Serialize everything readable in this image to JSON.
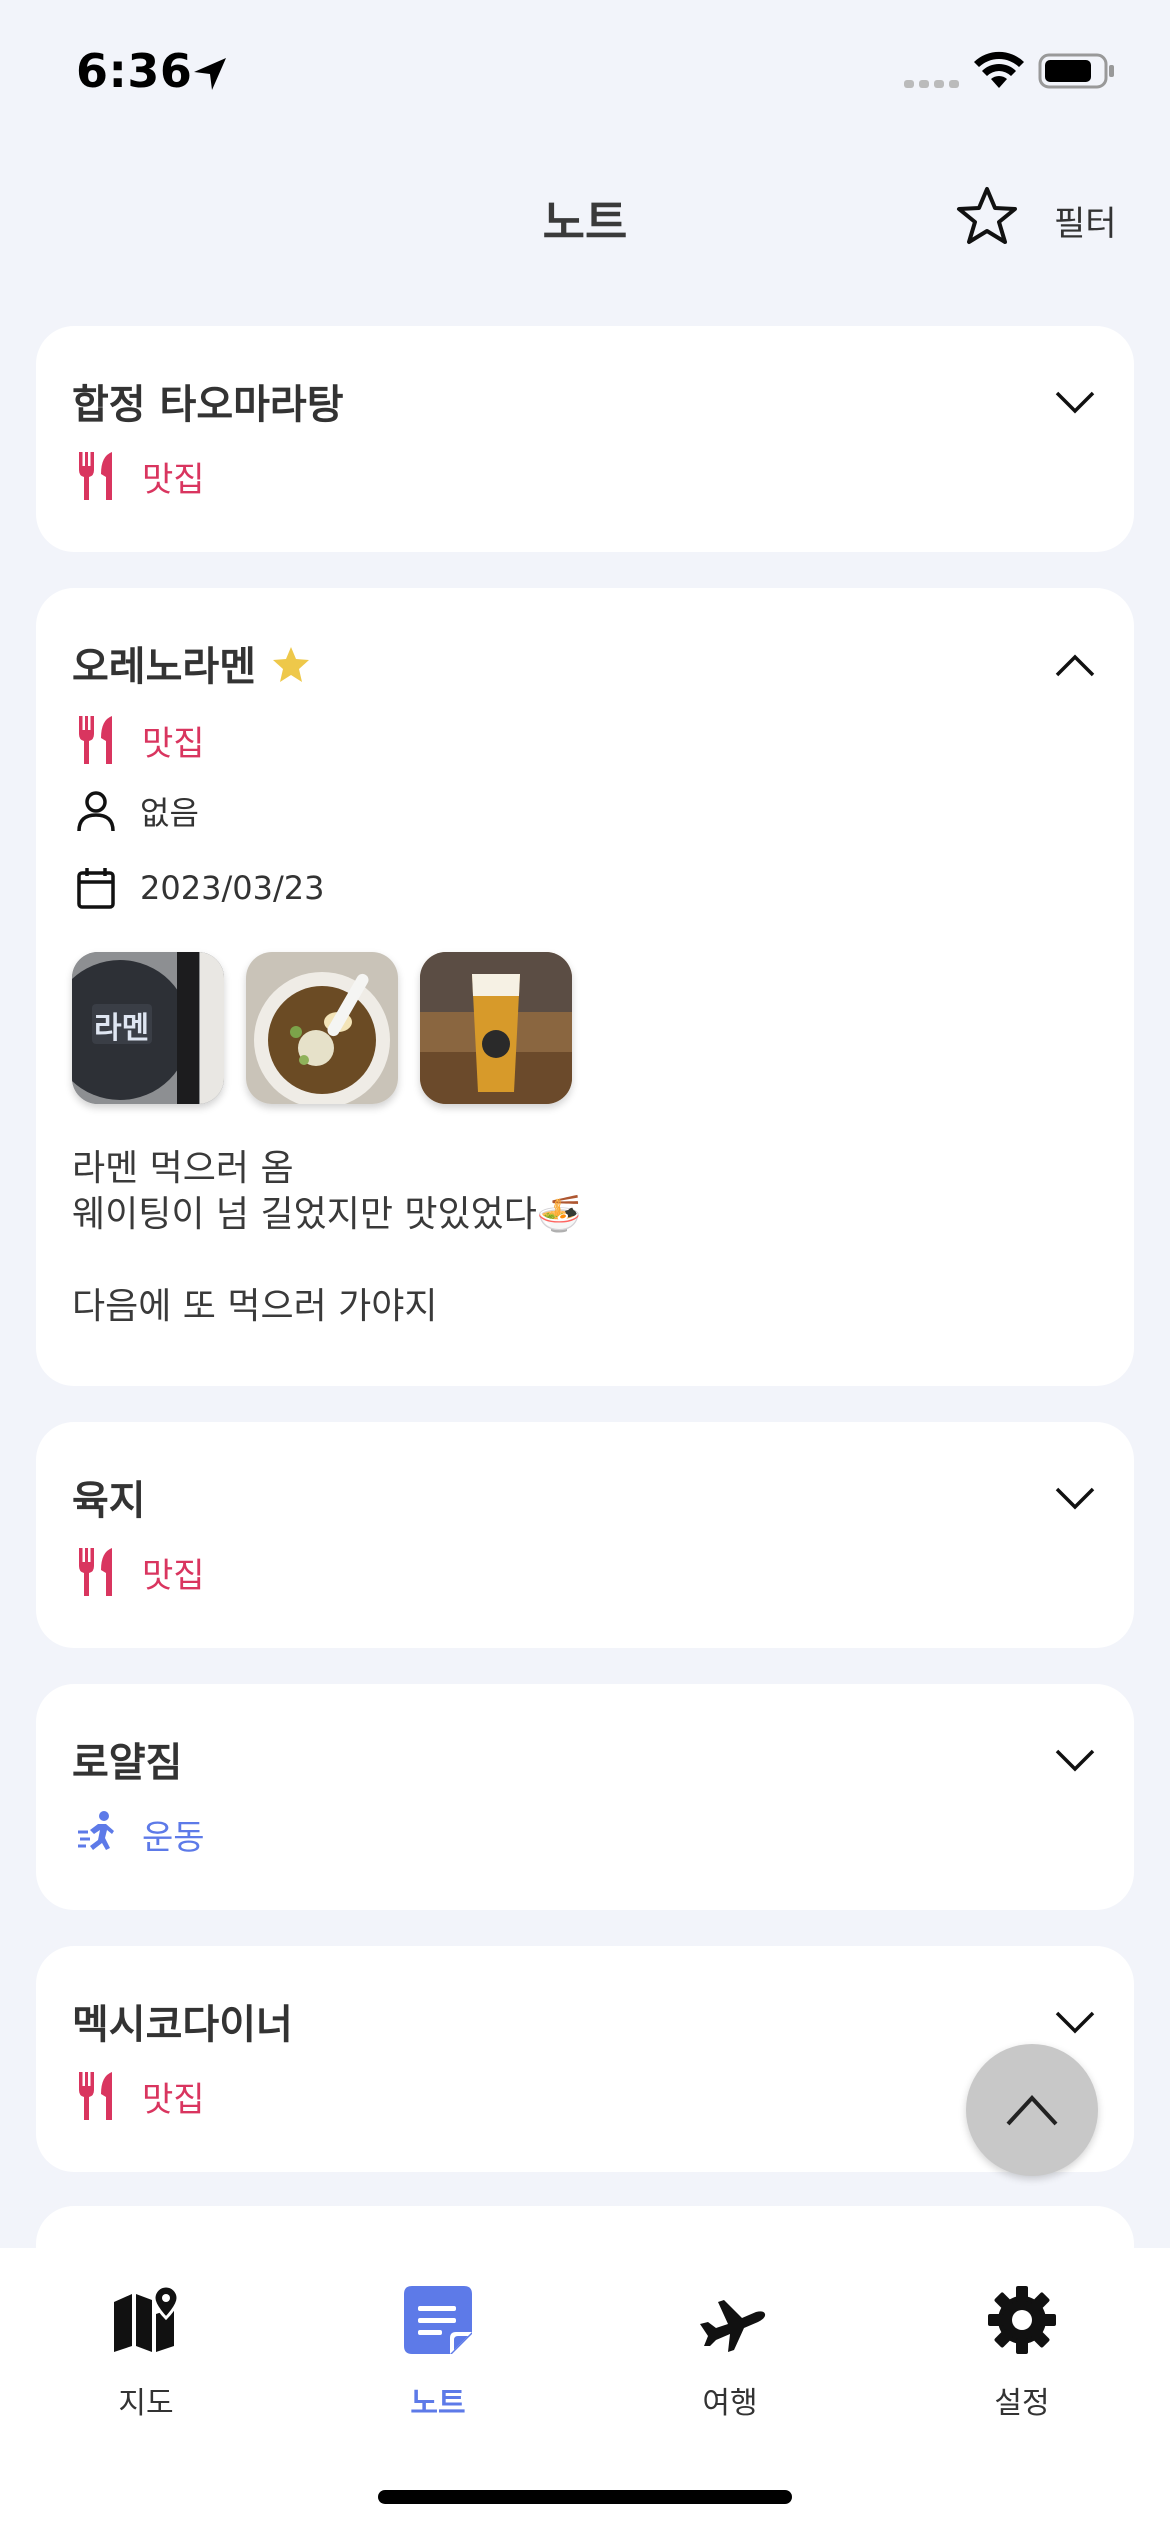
{
  "status_bar": {
    "time": "6:36"
  },
  "header": {
    "title": "노트",
    "filter_label": "필터"
  },
  "notes": [
    {
      "title": "합정 타오마라탕",
      "category": "맛집",
      "category_icon": "fork-knife-icon",
      "expanded": false
    },
    {
      "title": "오레노라멘",
      "favorite": true,
      "category": "맛집",
      "category_icon": "fork-knife-icon",
      "expanded": true,
      "companion": "없음",
      "date": "2023/03/23",
      "photos": [
        "ramen-shop-sign-photo",
        "ramen-bowl-photo",
        "beer-glass-photo"
      ],
      "memo_lines": [
        "라멘 먹으러 옴",
        "웨이팅이 넘 길었지만 맛있었다🍜",
        "",
        "다음에 또 먹으러 가야지"
      ]
    },
    {
      "title": "육지",
      "category": "맛집",
      "category_icon": "fork-knife-icon",
      "expanded": false
    },
    {
      "title": "로얄짐",
      "category": "운동",
      "category_icon": "running-icon",
      "expanded": false
    },
    {
      "title": "멕시코다이너",
      "category": "맛집",
      "category_icon": "fork-knife-icon",
      "expanded": false
    }
  ],
  "tabs": [
    {
      "label": "지도",
      "icon": "map-pin-icon",
      "active": false
    },
    {
      "label": "노트",
      "icon": "note-icon",
      "active": true
    },
    {
      "label": "여행",
      "icon": "airplane-icon",
      "active": false
    },
    {
      "label": "설정",
      "icon": "gear-icon",
      "active": false
    }
  ],
  "colors": {
    "accent": "#5d7ae8",
    "food": "#d9355f",
    "background": "#f2f4fa"
  }
}
